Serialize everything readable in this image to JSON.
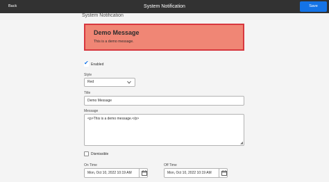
{
  "topbar": {
    "back_label": "Back",
    "title": "System Notification",
    "save_label": "Save"
  },
  "page": {
    "heading": "System Notification"
  },
  "preview": {
    "title": "Demo Message",
    "body": "This is a demo message.",
    "background_color": "#f08675",
    "border_color": "#d7373f"
  },
  "enabled": {
    "label": "Enabled",
    "checked": true
  },
  "style_field": {
    "label": "Style",
    "value": "Red"
  },
  "title_field": {
    "label": "Title",
    "value": "Demo Message"
  },
  "message_field": {
    "label": "Message",
    "value": "<p>This is a demo message.</p>"
  },
  "dismissible": {
    "label": "Dismissible",
    "checked": false
  },
  "on_time": {
    "label": "On Time",
    "value": "Mon, Oct 10, 2022 10:19 AM"
  },
  "off_time": {
    "label": "Off Time",
    "value": "Mon, Oct 10, 2022 10:19 AM"
  },
  "icons": {
    "check": "checkmark-icon",
    "chevron": "chevron-down-icon",
    "calendar": "calendar-icon",
    "resize": "resize-handle-icon"
  },
  "colors": {
    "accent": "#1473e6",
    "topbar": "#323232"
  }
}
